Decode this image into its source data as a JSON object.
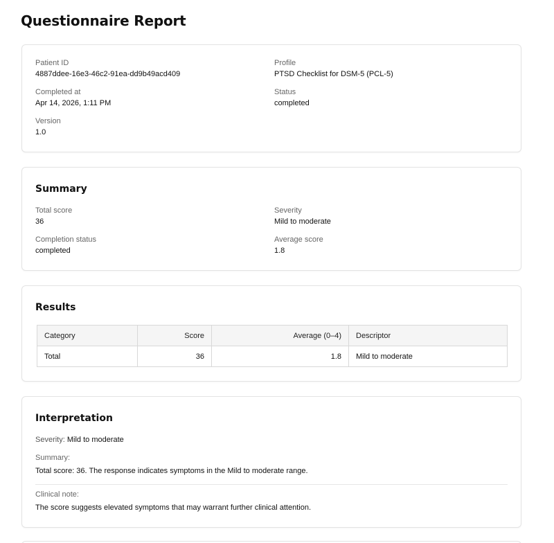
{
  "page": {
    "title": "Questionnaire Report"
  },
  "meta": {
    "patient_id_label": "Patient ID",
    "patient_id": "4887ddee-16e3-46c2-91ea-dd9b49acd409",
    "profile_label": "Profile",
    "profile": "PTSD Checklist for DSM-5 (PCL-5)",
    "completed_at_label": "Completed at",
    "completed_at": "Apr 14, 2026, 1:11 PM",
    "status_label": "Status",
    "status": "completed",
    "version_label": "Version",
    "version": "1.0"
  },
  "summary": {
    "title": "Summary",
    "total_score_label": "Total score",
    "total_score": "36",
    "severity_label": "Severity",
    "severity": "Mild to moderate",
    "completion_status_label": "Completion status",
    "completion_status": "completed",
    "average_score_label": "Average score",
    "average_score": "1.8"
  },
  "results": {
    "title": "Results",
    "headers": [
      "Category",
      "Score",
      "Average (0–4)",
      "Descriptor"
    ],
    "rows": [
      [
        "Total",
        "36",
        "1.8",
        "Mild to moderate"
      ]
    ]
  },
  "interpretation": {
    "title": "Interpretation",
    "severity_label": "Severity:",
    "severity": "Mild to moderate",
    "summary_label": "Summary:",
    "summary_text": "Total score: 36. The response indicates symptoms in the Mild to moderate range.",
    "clinical_note_label": "Clinical note:",
    "clinical_note_text": "The score suggests elevated symptoms that may warrant further clinical attention."
  }
}
